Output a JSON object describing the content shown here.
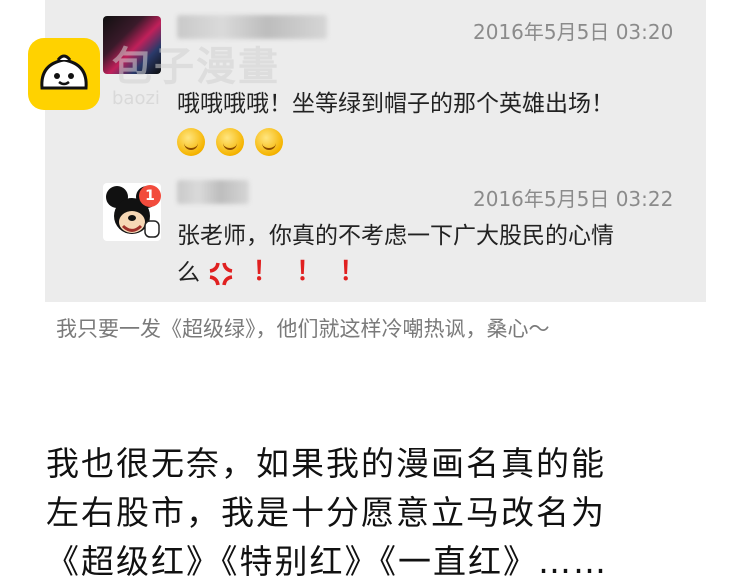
{
  "watermark": {
    "title": "包子漫畫",
    "subtitle": "baozi"
  },
  "comments": [
    {
      "timestamp": "2016年5月5日 03:20",
      "text": "哦哦哦哦！坐等绿到帽子的那个英雄出场！",
      "emoji_count": 3
    },
    {
      "timestamp": "2016年5月5日 03:22",
      "text_line1": "张老师，你真的不考虑一下广大股民的心情",
      "text_line2": "么",
      "badge": "1",
      "exclamations": [
        "！",
        "！",
        "！"
      ]
    }
  ],
  "caption": "我只要一发《超级绿》，他们就这样冷嘲热讽，桑心～",
  "body_lines": [
    "我也很无奈，如果我的漫画名真的能",
    "左右股市，我是十分愿意立马改名为",
    "《超级红》《特别红》《一直红》……"
  ],
  "colors": {
    "card_bg": "#ececec",
    "timestamp": "#8b8b8b",
    "exclamation": "#e02020",
    "badge": "#f24b3c",
    "logo": "#ffd200"
  }
}
